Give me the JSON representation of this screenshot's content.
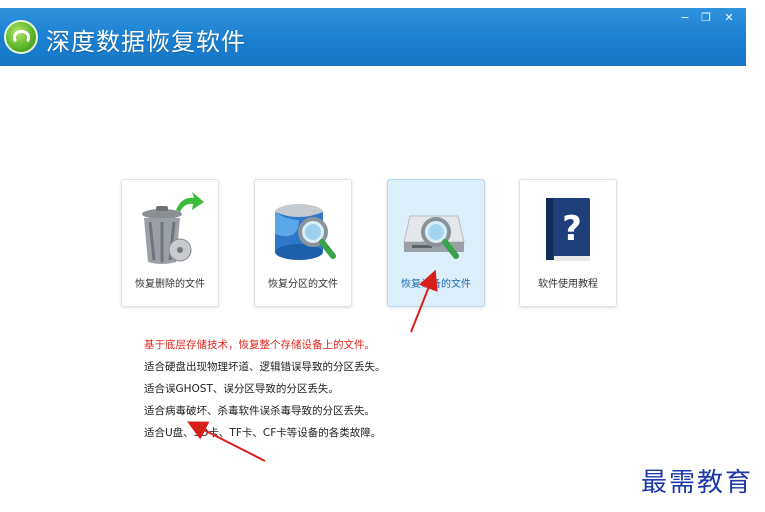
{
  "app": {
    "title": "深度数据恢复软件",
    "minimize_glyph": "−",
    "restore_glyph": "❐",
    "close_glyph": "✕"
  },
  "tiles": [
    {
      "label": "恢复删除的文件",
      "icon": "recycle-bin-icon",
      "active": false
    },
    {
      "label": "恢复分区的文件",
      "icon": "partition-disk-icon",
      "active": false
    },
    {
      "label": "恢复设备的文件",
      "icon": "device-drive-icon",
      "active": true
    },
    {
      "label": "软件使用教程",
      "icon": "help-book-icon",
      "active": false
    }
  ],
  "description": [
    "基于底层存储技术，恢复整个存储设备上的文件。",
    "适合硬盘出现物理坏道、逻辑错误导致的分区丢失。",
    "适合误GHOST、误分区导致的分区丢失。",
    "适合病毒破坏、杀毒软件误杀毒导致的分区丢失。",
    "适合U盘、SD卡、TF卡、CF卡等设备的各类故障。"
  ],
  "watermark": "最需教育",
  "colors": {
    "titlebar": "#1a7fd1",
    "highlight_text": "#e1261c",
    "active_tile": "#dbeefa",
    "annotation_arrow": "#d8201a"
  }
}
